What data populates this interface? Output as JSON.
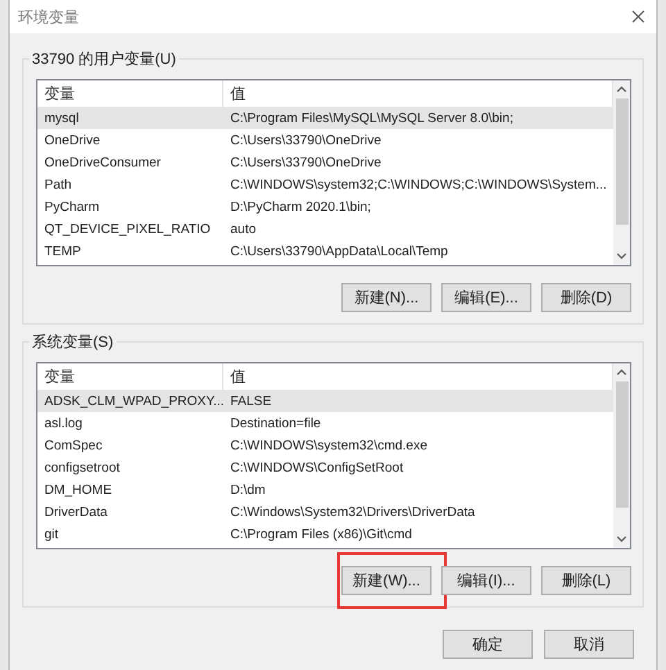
{
  "window": {
    "title": "环境变量"
  },
  "groups": [
    {
      "label": "33790 的用户变量(U)",
      "columns": [
        "变量",
        "值"
      ],
      "rows": [
        {
          "name": "mysql",
          "value": "C:\\Program Files\\MySQL\\MySQL Server 8.0\\bin;",
          "selected": true
        },
        {
          "name": "OneDrive",
          "value": "C:\\Users\\33790\\OneDrive",
          "selected": false
        },
        {
          "name": "OneDriveConsumer",
          "value": "C:\\Users\\33790\\OneDrive",
          "selected": false
        },
        {
          "name": "Path",
          "value": "C:\\WINDOWS\\system32;C:\\WINDOWS;C:\\WINDOWS\\System...",
          "selected": false
        },
        {
          "name": "PyCharm",
          "value": "D:\\PyCharm 2020.1\\bin;",
          "selected": false
        },
        {
          "name": "QT_DEVICE_PIXEL_RATIO",
          "value": "auto",
          "selected": false
        },
        {
          "name": "TEMP",
          "value": "C:\\Users\\33790\\AppData\\Local\\Temp",
          "selected": false
        }
      ],
      "buttons": [
        {
          "label": "新建(N)..."
        },
        {
          "label": "编辑(E)..."
        },
        {
          "label": "删除(D)"
        }
      ]
    },
    {
      "label": "系统变量(S)",
      "columns": [
        "变量",
        "值"
      ],
      "rows": [
        {
          "name": "ADSK_CLM_WPAD_PROXY...",
          "value": "FALSE",
          "selected": true
        },
        {
          "name": "asl.log",
          "value": "Destination=file",
          "selected": false
        },
        {
          "name": "ComSpec",
          "value": "C:\\WINDOWS\\system32\\cmd.exe",
          "selected": false
        },
        {
          "name": "configsetroot",
          "value": "C:\\WINDOWS\\ConfigSetRoot",
          "selected": false
        },
        {
          "name": "DM_HOME",
          "value": "D:\\dm",
          "selected": false
        },
        {
          "name": "DriverData",
          "value": "C:\\Windows\\System32\\Drivers\\DriverData",
          "selected": false
        },
        {
          "name": "git",
          "value": "C:\\Program Files (x86)\\Git\\cmd",
          "selected": false
        }
      ],
      "buttons": [
        {
          "label": "新建(W)...",
          "highlighted": true
        },
        {
          "label": "编辑(I)..."
        },
        {
          "label": "删除(L)"
        }
      ]
    }
  ],
  "footer_buttons": [
    "确定",
    "取消"
  ]
}
